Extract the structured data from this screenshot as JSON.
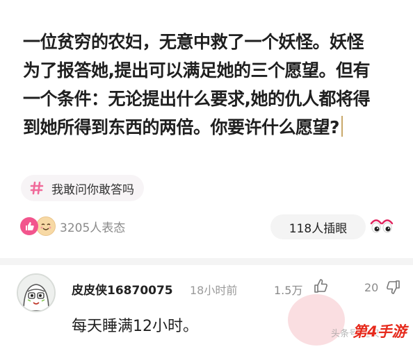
{
  "post": {
    "lines": [
      "一位贫穷的农妇，无意中救了一个妖怪。妖怪",
      "为了报答她,提出可以满足她的三个愿望。但有",
      "一个条件：无论提出什么要求,她的仇人都将得",
      "到她所得到东西的两倍。你要许什么愿望?"
    ]
  },
  "topic": {
    "hash_icon": "hash-icon",
    "label": "我敢问你敢答吗"
  },
  "reactions": {
    "count_text": "3205人表态",
    "insert_label": "118人插眼",
    "icons": [
      "like-heart-icon",
      "smile-face-icon",
      "eyes-icon"
    ]
  },
  "comment": {
    "username": "皮皮侠16870075",
    "time": "18小时前",
    "likes": "1.5万",
    "dislikes": "20",
    "text": "每天睡满12小时。"
  },
  "watermark": {
    "source": "头条号/星汉",
    "logo": "第4手游"
  },
  "colors": {
    "like_pink": "#f2558d",
    "hash_pink": "#f06a9a",
    "logo_red": "#e62a1c"
  }
}
